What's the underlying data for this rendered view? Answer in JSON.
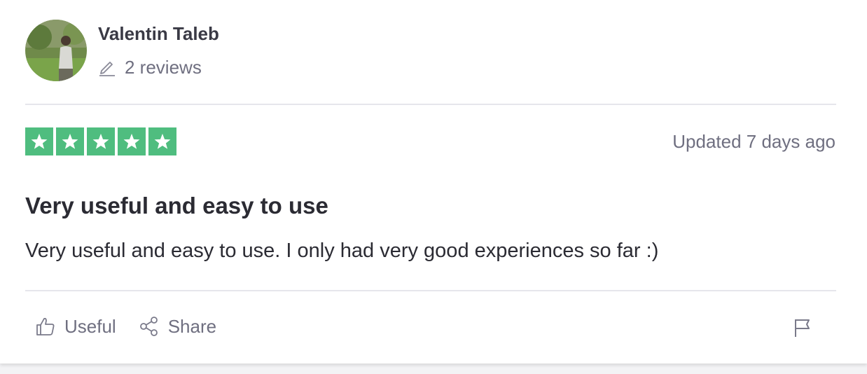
{
  "consumer": {
    "name": "Valentin Taleb",
    "reviews_count": "2 reviews",
    "avatar_icon": "user-photo"
  },
  "review": {
    "rating": 5,
    "rating_max": 5,
    "star_color": "#4fbd7f",
    "date": "Updated 7 days ago",
    "title": "Very useful and easy to use",
    "text": "Very useful and easy to use. I only had very good experiences so far :)"
  },
  "actions": {
    "useful_label": "Useful",
    "useful_icon": "thumbs-up-icon",
    "share_label": "Share",
    "share_icon": "share-icon",
    "flag_icon": "flag-icon"
  }
}
